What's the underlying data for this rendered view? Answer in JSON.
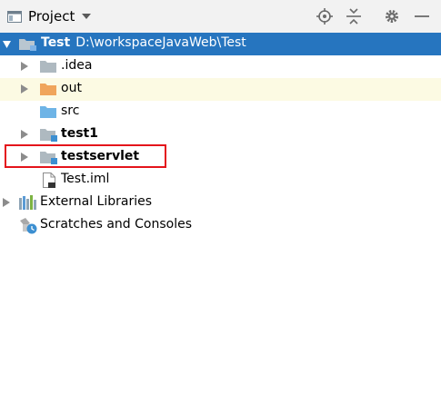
{
  "header": {
    "title": "Project",
    "icons": [
      "project-view-icon",
      "dropdown-caret-icon",
      "locate-icon",
      "collapse-all-icon",
      "settings-gear-icon",
      "hide-minimize-icon"
    ]
  },
  "tree": {
    "root": {
      "name": "Test",
      "path": "D:\\workspaceJavaWeb\\Test",
      "icon": "module-folder-icon",
      "expanded": true,
      "selected": true
    },
    "items": [
      {
        "name": ".idea",
        "icon": "folder-icon",
        "expandable": true,
        "bold": false
      },
      {
        "name": "out",
        "icon": "excluded-folder-icon",
        "expandable": true,
        "bold": false
      },
      {
        "name": "src",
        "icon": "source-folder-icon",
        "expandable": false,
        "bold": false
      },
      {
        "name": "test1",
        "icon": "module-folder-icon",
        "expandable": true,
        "bold": true
      },
      {
        "name": "testservlet",
        "icon": "module-folder-icon",
        "expandable": true,
        "bold": true
      },
      {
        "name": "Test.iml",
        "icon": "iml-file-icon",
        "expandable": false,
        "bold": false
      }
    ],
    "external_libraries": {
      "name": "External Libraries",
      "icon": "libraries-icon",
      "expandable": true
    },
    "scratches": {
      "name": "Scratches and Consoles",
      "icon": "scratches-icon",
      "expandable": false
    }
  },
  "colors": {
    "selection": "#2675bf",
    "hover_row": "#fcfae3",
    "folder": "#aeb9c0",
    "excluded_folder": "#f0a55c",
    "source_folder": "#6eb4e6",
    "module_badge": "#3c8fd1",
    "annotation_box": "#e4141b"
  }
}
